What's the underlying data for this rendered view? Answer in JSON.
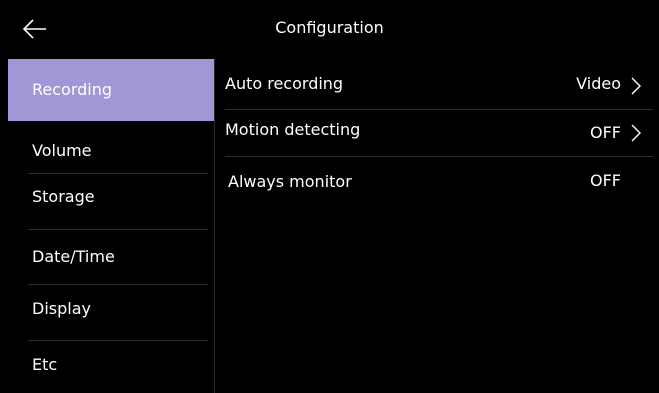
{
  "header": {
    "title": "Configuration",
    "back_icon": "arrow-left-icon"
  },
  "sidebar": {
    "items": [
      {
        "label": "Recording",
        "active": true
      },
      {
        "label": "Volume",
        "active": false
      },
      {
        "label": "Storage",
        "active": false
      },
      {
        "label": "Date/Time",
        "active": false
      },
      {
        "label": "Display",
        "active": false
      },
      {
        "label": "Etc",
        "active": false
      }
    ]
  },
  "settings": {
    "rows": [
      {
        "label": "Auto recording",
        "value": "Video",
        "has_chevron": true
      },
      {
        "label": "Motion detecting",
        "value": "OFF",
        "has_chevron": true
      },
      {
        "label": "Always monitor",
        "value": "OFF",
        "has_chevron": false
      }
    ]
  },
  "colors": {
    "background": "#000000",
    "active_item": "#a196d6",
    "divider": "#2f2f2f",
    "text": "#ffffff"
  }
}
